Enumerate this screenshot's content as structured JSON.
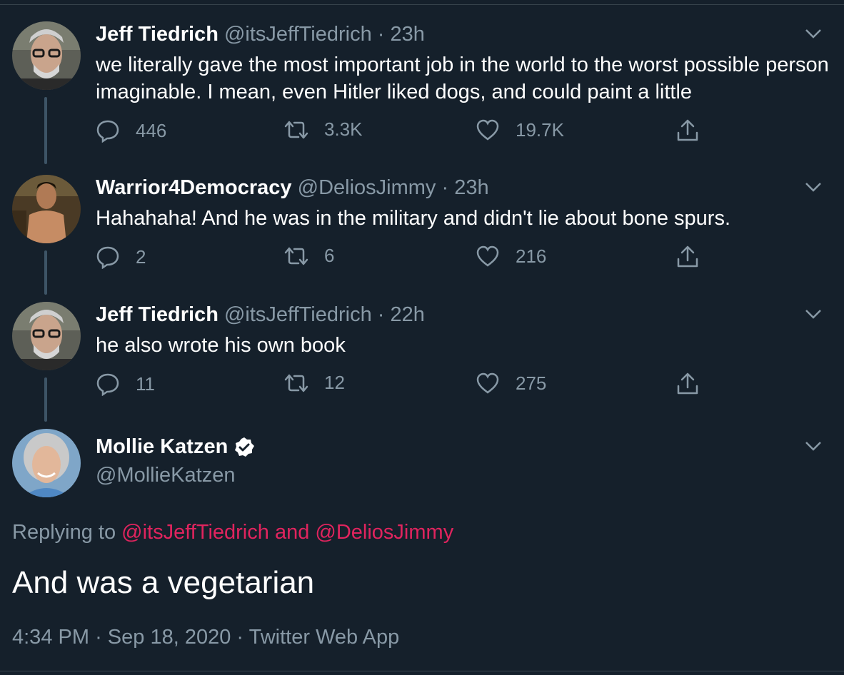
{
  "tweets": [
    {
      "name": "Jeff Tiedrich",
      "handle": "@itsJeffTiedrich",
      "time": "23h",
      "text": "we literally gave the most important job in the world to the worst possible person imaginable. I mean, even Hitler liked dogs, and could paint a little",
      "replies": "446",
      "retweets": "3.3K",
      "likes": "19.7K"
    },
    {
      "name": "Warrior4Democracy",
      "handle": "@DeliosJimmy",
      "time": "23h",
      "text": "Hahahaha! And he was in the military and didn't lie about bone spurs.",
      "replies": "2",
      "retweets": "6",
      "likes": "216"
    },
    {
      "name": "Jeff Tiedrich",
      "handle": "@itsJeffTiedrich",
      "time": "22h",
      "text": "he also wrote his own book",
      "replies": "11",
      "retweets": "12",
      "likes": "275"
    }
  ],
  "separator": "·",
  "main": {
    "name": "Mollie Katzen",
    "handle": "@MollieKatzen",
    "replying_prefix": "Replying to",
    "replying_to_1": "@itsJeffTiedrich",
    "replying_and": "and",
    "replying_to_2": "@DeliosJimmy",
    "text": "And was a vegetarian",
    "time": "4:34 PM",
    "date": "Sep 18, 2020",
    "source": "Twitter Web App"
  },
  "colors": {
    "background": "#15202b",
    "secondary_text": "#8899a6",
    "mention": "#e0245e",
    "thread_line": "#3d5466"
  }
}
